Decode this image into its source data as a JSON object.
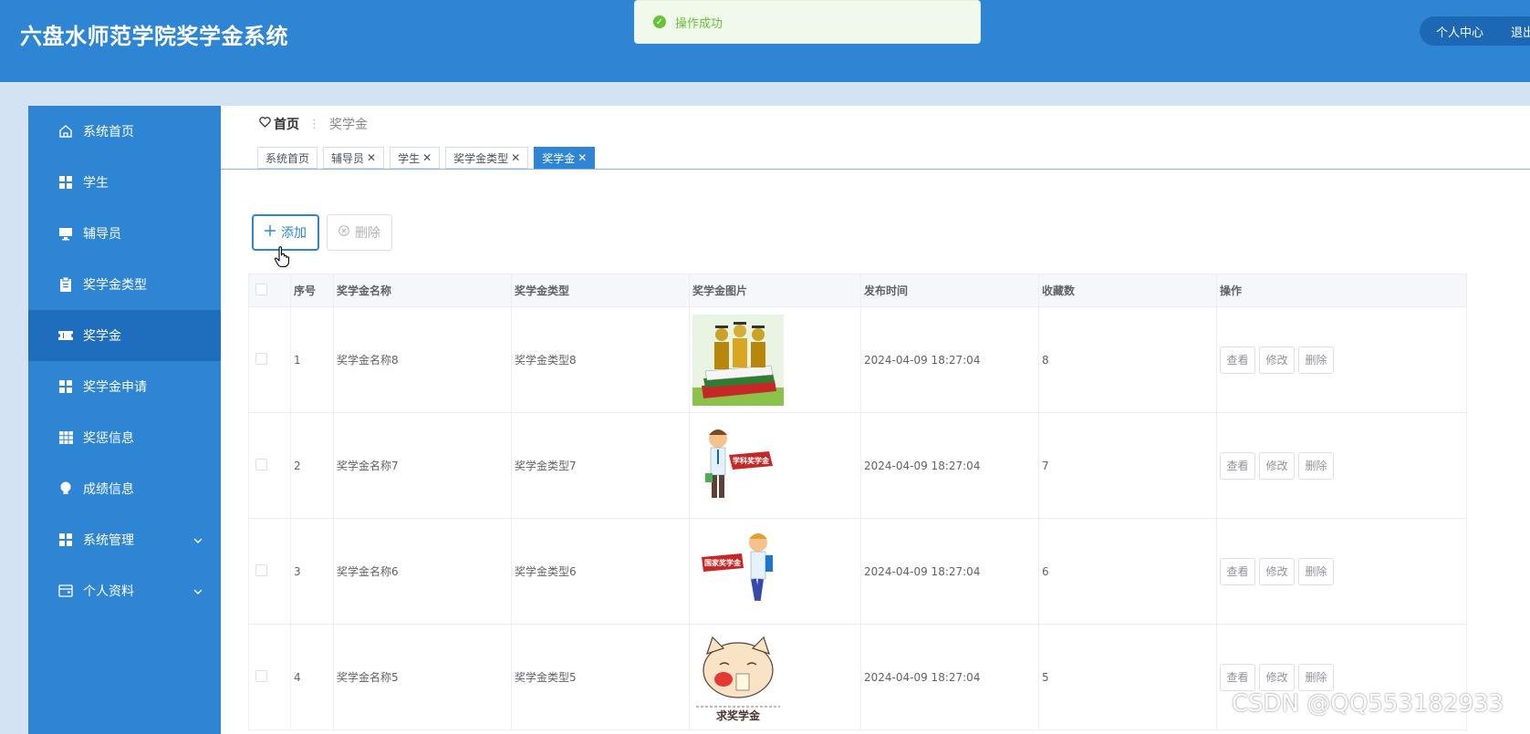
{
  "header": {
    "app_title": "六盘水师范学院奖学金系统",
    "user_center": "个人中心",
    "logout": "退出"
  },
  "toast": {
    "message": "操作成功",
    "icon": "check-circle-icon",
    "color": "#67c23a"
  },
  "colors": {
    "primary": "#2d85d3",
    "sidebar_active": "#1f6ebd",
    "background": "#d4e3f3"
  },
  "sidebar": {
    "items": [
      {
        "label": "系统首页",
        "icon": "home-icon"
      },
      {
        "label": "学生",
        "icon": "grid-icon"
      },
      {
        "label": "辅导员",
        "icon": "monitor-icon"
      },
      {
        "label": "奖学金类型",
        "icon": "clipboard-icon"
      },
      {
        "label": "奖学金",
        "icon": "ticket-icon",
        "active": true
      },
      {
        "label": "奖学金申请",
        "icon": "grid-icon"
      },
      {
        "label": "奖惩信息",
        "icon": "table-icon"
      },
      {
        "label": "成绩信息",
        "icon": "bulb-icon"
      },
      {
        "label": "系统管理",
        "icon": "grid-icon",
        "has_children": true
      },
      {
        "label": "个人资料",
        "icon": "wallet-icon",
        "has_children": true
      }
    ]
  },
  "breadcrumb": {
    "home": "首页",
    "current": "奖学金"
  },
  "tabs": [
    {
      "label": "系统首页",
      "closable": false
    },
    {
      "label": "辅导员",
      "closable": true
    },
    {
      "label": "学生",
      "closable": true
    },
    {
      "label": "奖学金类型",
      "closable": true
    },
    {
      "label": "奖学金",
      "closable": true,
      "active": true
    }
  ],
  "toolbar": {
    "add_label": "添加",
    "delete_label": "删除"
  },
  "table": {
    "columns": [
      "序号",
      "奖学金名称",
      "奖学金类型",
      "奖学金图片",
      "发布时间",
      "收藏数",
      "操作"
    ],
    "rows": [
      {
        "index": "1",
        "name": "奖学金名称8",
        "type": "奖学金类型8",
        "image": "coins-on-books",
        "published": "2024-04-09 18:27:04",
        "favorites": "8"
      },
      {
        "index": "2",
        "name": "奖学金名称7",
        "type": "奖学金类型7",
        "image": "student-with-banner",
        "image_caption": "学科奖学金",
        "published": "2024-04-09 18:27:04",
        "favorites": "7"
      },
      {
        "index": "3",
        "name": "奖学金名称6",
        "type": "奖学金类型6",
        "image": "student-running-banner",
        "image_caption": "国家奖学金",
        "published": "2024-04-09 18:27:04",
        "favorites": "6"
      },
      {
        "index": "4",
        "name": "奖学金名称5",
        "type": "奖学金类型5",
        "image": "cartoon-cat",
        "image_caption": "求奖学金",
        "published": "2024-04-09 18:27:04",
        "favorites": "5"
      }
    ],
    "actions": {
      "view": "查看",
      "edit": "修改",
      "delete": "删除"
    }
  },
  "watermark": "CSDN @QQ553182933"
}
